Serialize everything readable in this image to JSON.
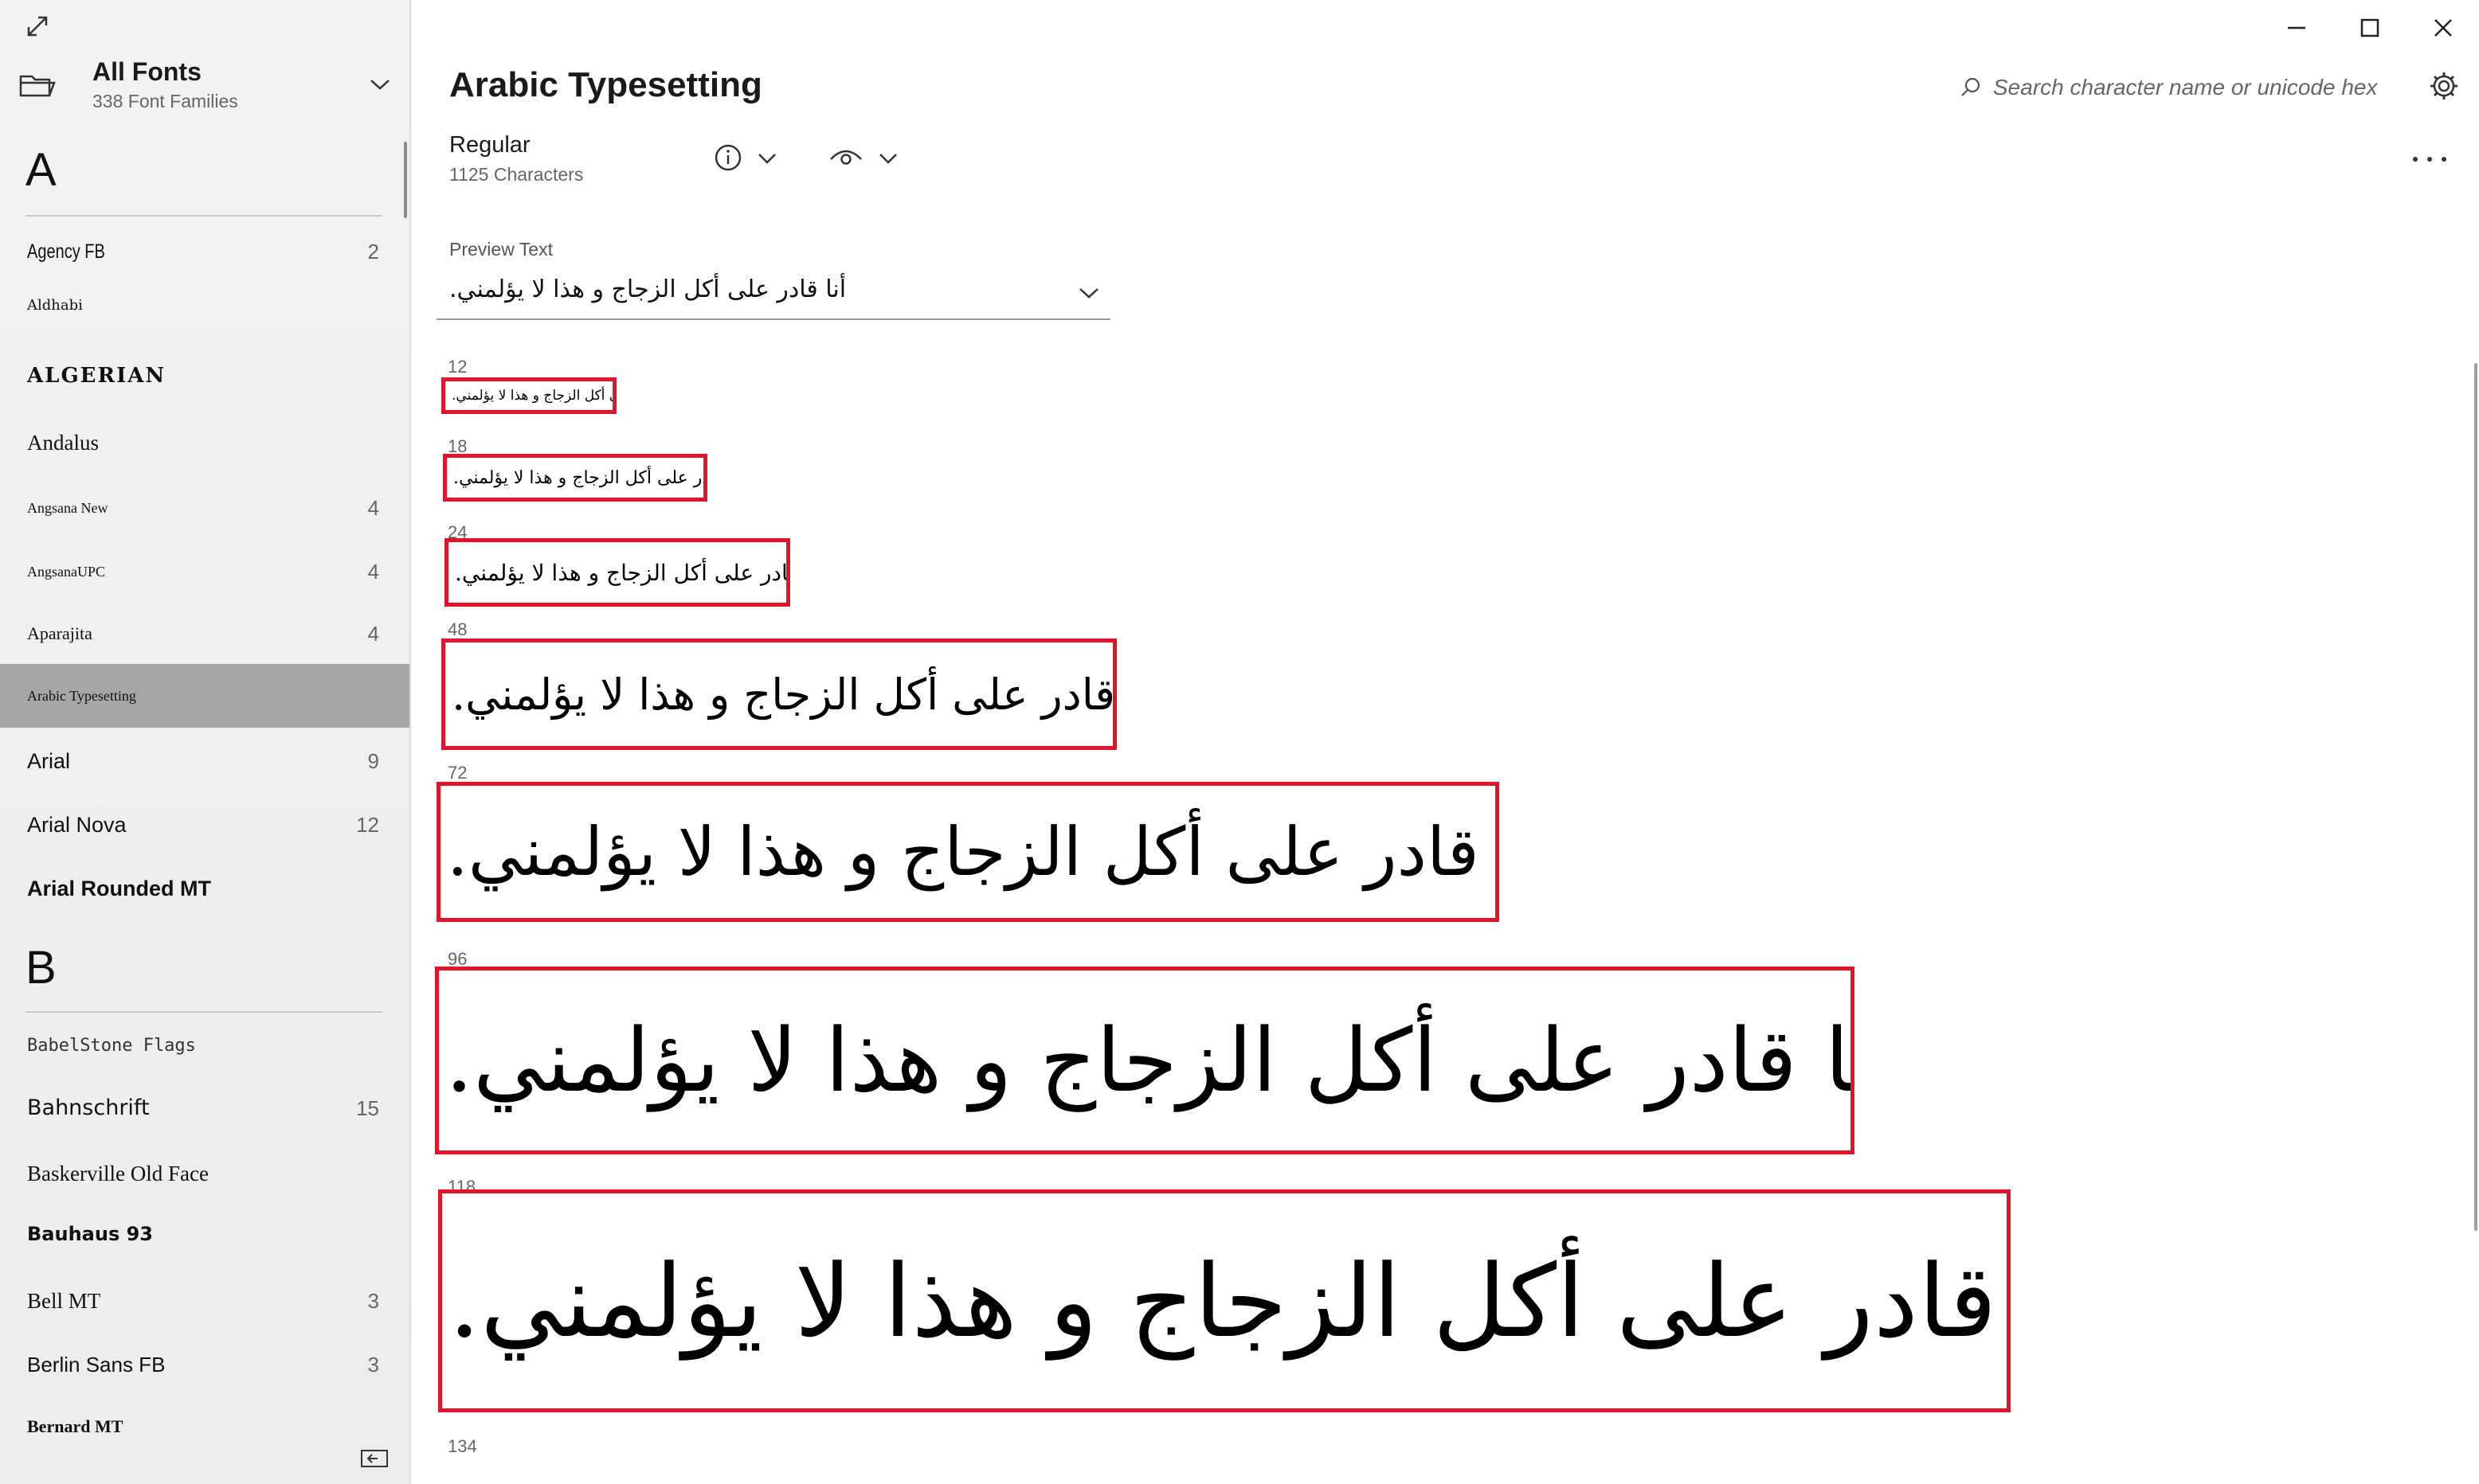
{
  "sidebar": {
    "collection_title": "All Fonts",
    "collection_subtitle": "338 Font Families",
    "groups": [
      {
        "letter": "A",
        "items": [
          {
            "name": "Agency FB",
            "count": "2"
          },
          {
            "name": "Aldhabi",
            "count": ""
          },
          {
            "name": "ALGERIAN",
            "count": ""
          },
          {
            "name": "Andalus",
            "count": ""
          },
          {
            "name": "Angsana New",
            "count": "4"
          },
          {
            "name": "AngsanaUPC",
            "count": "4"
          },
          {
            "name": "Aparajita",
            "count": "4"
          },
          {
            "name": "Arabic Typesetting",
            "count": ""
          },
          {
            "name": "Arial",
            "count": "9"
          },
          {
            "name": "Arial Nova",
            "count": "12"
          },
          {
            "name": "Arial Rounded MT",
            "count": ""
          }
        ]
      },
      {
        "letter": "B",
        "items": [
          {
            "name": "BabelStone Flags",
            "count": ""
          },
          {
            "name": "Bahnschrift",
            "count": "15"
          },
          {
            "name": "Baskerville Old Face",
            "count": ""
          },
          {
            "name": "Bauhaus 93",
            "count": ""
          },
          {
            "name": "Bell MT",
            "count": "3"
          },
          {
            "name": "Berlin Sans FB",
            "count": "3"
          },
          {
            "name": "Bernard MT",
            "count": ""
          }
        ]
      }
    ],
    "selected_item": "Arabic Typesetting"
  },
  "main": {
    "font_title": "Arabic Typesetting",
    "style_name": "Regular",
    "character_count": "1125 Characters",
    "search_placeholder": "Search character name or unicode hex",
    "preview_label": "Preview Text",
    "preview_text": "أنا قادر على أكل الزجاج و هذا لا يؤلمني.",
    "samples": [
      {
        "size": "12"
      },
      {
        "size": "18"
      },
      {
        "size": "24"
      },
      {
        "size": "48"
      },
      {
        "size": "72"
      },
      {
        "size": "96"
      },
      {
        "size": "118"
      },
      {
        "size": "134"
      }
    ]
  },
  "colors": {
    "highlight_box": "#e0142a",
    "selected_row": "#a6a6a6",
    "sidebar_bg": "#f2f2f2"
  }
}
